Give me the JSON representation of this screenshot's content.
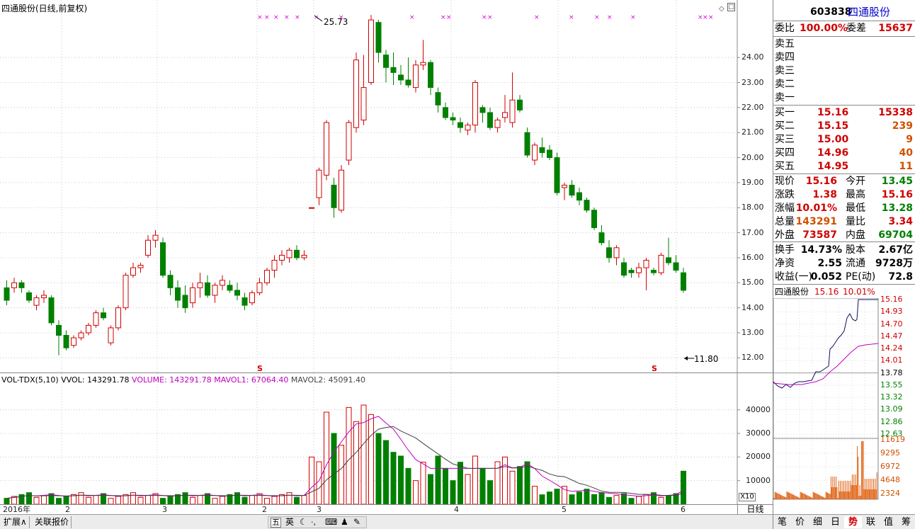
{
  "chart_header": {
    "title": "四通股份(日线,前复权)"
  },
  "price_axis": {
    "ticks": [
      "24.00",
      "23.00",
      "22.00",
      "21.00",
      "20.00",
      "19.00",
      "18.00",
      "17.00",
      "16.00",
      "15.00",
      "14.00",
      "13.00",
      "12.00"
    ]
  },
  "annotations": {
    "high_label": "25.73",
    "low_label": "11.80",
    "s_marker": "S"
  },
  "x_axis": {
    "labels": [
      "2016年",
      "2",
      "3",
      "2",
      "3",
      "4",
      "5",
      "6"
    ],
    "period_label": "日线",
    "scale_label": "X10"
  },
  "vol_header": {
    "indicator": "VOL-TDX(5,10)",
    "vvol": "VVOL: 143291.78",
    "volume": "VOLUME: 143291.78",
    "mavol1": "MAVOL1: 67064.40",
    "mavol2": "MAVOL2: 45091.40"
  },
  "vol_axis": {
    "ticks": [
      "40000",
      "30000",
      "20000",
      "10000"
    ]
  },
  "bottom_tabs": [
    "扩展∧",
    "关联报价"
  ],
  "tool_icons": [
    "五",
    "英"
  ],
  "colors": {
    "up": "#d00000",
    "down": "#008000",
    "ma1": "#c000c0",
    "ma2": "#404040",
    "marker": "#e000e0"
  },
  "quote": {
    "code": "603838",
    "name": "四通股份",
    "weibi_label": "委比",
    "weibi_value": "100.00%",
    "weicha_label": "委差",
    "weicha_value": "15637",
    "asks": [
      {
        "label": "卖五",
        "price": "",
        "vol": ""
      },
      {
        "label": "卖四",
        "price": "",
        "vol": ""
      },
      {
        "label": "卖三",
        "price": "",
        "vol": ""
      },
      {
        "label": "卖二",
        "price": "",
        "vol": ""
      },
      {
        "label": "卖一",
        "price": "",
        "vol": ""
      }
    ],
    "bids": [
      {
        "label": "买一",
        "price": "15.16",
        "vol": "15338"
      },
      {
        "label": "买二",
        "price": "15.15",
        "vol": "239"
      },
      {
        "label": "买三",
        "price": "15.00",
        "vol": "9"
      },
      {
        "label": "买四",
        "price": "14.96",
        "vol": "40"
      },
      {
        "label": "买五",
        "price": "14.95",
        "vol": "11"
      }
    ],
    "stats": [
      {
        "l1": "现价",
        "v1": "15.16",
        "l2": "今开",
        "v2": "13.45",
        "c1": "red",
        "c2": "green"
      },
      {
        "l1": "涨跌",
        "v1": "1.38",
        "l2": "最高",
        "v2": "15.16",
        "c1": "red",
        "c2": "red"
      },
      {
        "l1": "涨幅",
        "v1": "10.01%",
        "l2": "最低",
        "v2": "13.28",
        "c1": "red",
        "c2": "green"
      },
      {
        "l1": "总量",
        "v1": "143291",
        "l2": "量比",
        "v2": "3.34",
        "c1": "orange",
        "c2": "red"
      },
      {
        "l1": "外盘",
        "v1": "73587",
        "l2": "内盘",
        "v2": "69704",
        "c1": "red",
        "c2": "green"
      }
    ],
    "fundamentals": [
      {
        "l1": "换手",
        "v1": "14.73%",
        "l2": "股本",
        "v2": "2.67亿"
      },
      {
        "l1": "净资",
        "v1": "2.55",
        "l2": "流通",
        "v2": "9728万"
      },
      {
        "l1": "收益(一)",
        "v1": "0.052",
        "l2": "PE(动)",
        "v2": "72.8"
      }
    ]
  },
  "mini_chart": {
    "name": "四通股份",
    "price": "15.16",
    "pct": "10.01%",
    "price_ticks": [
      "15.16",
      "14.93",
      "14.70",
      "14.47",
      "14.24",
      "14.01",
      "13.78",
      "13.55",
      "13.32",
      "13.09",
      "12.86",
      "12.63"
    ],
    "vol_ticks": [
      "11619",
      "9295",
      "6972",
      "4648",
      "2324"
    ]
  },
  "right_tabs": [
    "笔",
    "价",
    "细",
    "日",
    "势",
    "联",
    "值",
    "筹"
  ],
  "chart_data": {
    "type": "candlestick",
    "title": "四通股份(日线,前复权)",
    "ylim": [
      11.5,
      25.9
    ],
    "series_note": "daily candles, 96 sessions, open/high/low/close in CNY",
    "candles": [
      [
        14.8,
        15.1,
        14.1,
        14.3
      ],
      [
        14.8,
        15.2,
        14.6,
        15.0
      ],
      [
        15.0,
        15.1,
        14.6,
        14.8
      ],
      [
        14.6,
        14.7,
        14.2,
        14.3
      ],
      [
        14.1,
        14.5,
        13.9,
        14.4
      ],
      [
        14.4,
        14.7,
        14.2,
        14.5
      ],
      [
        14.4,
        14.5,
        13.3,
        13.4
      ],
      [
        13.3,
        13.5,
        12.1,
        12.9
      ],
      [
        12.9,
        13.1,
        12.3,
        12.4
      ],
      [
        12.5,
        12.9,
        12.4,
        12.8
      ],
      [
        12.8,
        13.1,
        12.7,
        13.0
      ],
      [
        13.0,
        13.4,
        12.9,
        13.3
      ],
      [
        13.3,
        13.9,
        13.2,
        13.8
      ],
      [
        13.8,
        14.0,
        13.5,
        13.6
      ],
      [
        12.6,
        13.3,
        12.5,
        13.2
      ],
      [
        13.2,
        14.1,
        13.1,
        14.0
      ],
      [
        14.0,
        15.4,
        13.9,
        15.3
      ],
      [
        15.3,
        15.8,
        15.2,
        15.6
      ],
      [
        15.6,
        15.8,
        15.4,
        15.7
      ],
      [
        16.1,
        16.9,
        16.0,
        16.7
      ],
      [
        16.7,
        17.1,
        16.4,
        16.9
      ],
      [
        16.6,
        16.8,
        15.2,
        15.3
      ],
      [
        15.3,
        15.5,
        14.5,
        14.8
      ],
      [
        14.8,
        15.1,
        14.0,
        14.3
      ],
      [
        14.5,
        14.9,
        13.8,
        14.0
      ],
      [
        14.2,
        15.0,
        14.0,
        14.8
      ],
      [
        14.8,
        15.4,
        14.4,
        15.0
      ],
      [
        15.0,
        15.3,
        14.4,
        14.5
      ],
      [
        14.5,
        15.0,
        14.2,
        14.9
      ],
      [
        14.9,
        15.3,
        14.7,
        15.1
      ],
      [
        14.9,
        15.1,
        14.6,
        14.7
      ],
      [
        14.7,
        15.0,
        14.3,
        14.5
      ],
      [
        14.4,
        14.6,
        13.9,
        14.1
      ],
      [
        14.2,
        14.7,
        14.1,
        14.6
      ],
      [
        14.6,
        15.2,
        14.5,
        15.0
      ],
      [
        15.0,
        15.6,
        14.9,
        15.5
      ],
      [
        15.5,
        16.1,
        15.2,
        15.9
      ],
      [
        15.9,
        16.3,
        15.7,
        16.1
      ],
      [
        16.0,
        16.4,
        15.8,
        16.3
      ],
      [
        16.3,
        16.5,
        15.9,
        16.0
      ],
      [
        16.0,
        16.3,
        15.9,
        16.1
      ],
      [
        18.0,
        18.0,
        18.0,
        18.0
      ],
      [
        18.4,
        19.6,
        18.1,
        19.5
      ],
      [
        19.3,
        21.5,
        19.1,
        21.4
      ],
      [
        18.9,
        19.2,
        17.6,
        18.0
      ],
      [
        17.9,
        19.7,
        17.8,
        19.5
      ],
      [
        19.9,
        21.5,
        19.7,
        21.4
      ],
      [
        21.2,
        24.2,
        21.0,
        23.9
      ],
      [
        21.5,
        24.1,
        21.3,
        22.8
      ],
      [
        23.0,
        25.7,
        22.9,
        25.5
      ],
      [
        25.4,
        25.5,
        23.8,
        24.2
      ],
      [
        24.1,
        24.3,
        23.0,
        23.6
      ],
      [
        23.6,
        24.2,
        22.9,
        23.4
      ],
      [
        23.3,
        23.7,
        22.9,
        23.1
      ],
      [
        23.1,
        24.0,
        22.8,
        22.9
      ],
      [
        22.8,
        23.9,
        22.6,
        23.7
      ],
      [
        23.7,
        24.7,
        23.5,
        23.8
      ],
      [
        23.8,
        23.9,
        22.5,
        22.8
      ],
      [
        22.6,
        22.8,
        21.8,
        22.1
      ],
      [
        22.0,
        22.2,
        21.5,
        21.6
      ],
      [
        21.6,
        21.8,
        21.3,
        21.5
      ],
      [
        21.4,
        21.6,
        21.0,
        21.2
      ],
      [
        21.1,
        21.4,
        20.9,
        21.3
      ],
      [
        21.3,
        23.1,
        21.0,
        23.0
      ],
      [
        22.0,
        22.1,
        21.4,
        21.8
      ],
      [
        21.8,
        22.0,
        21.1,
        21.2
      ],
      [
        21.2,
        21.6,
        21.0,
        21.5
      ],
      [
        21.6,
        22.5,
        21.4,
        21.8
      ],
      [
        21.4,
        23.4,
        21.2,
        22.3
      ],
      [
        22.3,
        22.5,
        21.8,
        21.9
      ],
      [
        21.0,
        21.2,
        20.0,
        20.1
      ],
      [
        19.9,
        20.6,
        19.7,
        20.5
      ],
      [
        20.4,
        20.8,
        20.0,
        20.2
      ],
      [
        20.3,
        20.5,
        19.9,
        20.0
      ],
      [
        20.0,
        20.2,
        18.5,
        18.6
      ],
      [
        18.8,
        19.0,
        18.3,
        18.9
      ],
      [
        18.9,
        19.1,
        18.4,
        18.5
      ],
      [
        18.6,
        18.8,
        18.1,
        18.3
      ],
      [
        18.3,
        18.4,
        17.8,
        17.9
      ],
      [
        17.9,
        18.0,
        17.1,
        17.2
      ],
      [
        17.0,
        17.3,
        16.5,
        16.6
      ],
      [
        16.4,
        16.7,
        15.8,
        16.0
      ],
      [
        16.0,
        16.5,
        15.7,
        16.4
      ],
      [
        15.8,
        16.0,
        15.2,
        15.3
      ],
      [
        15.5,
        15.6,
        15.2,
        15.4
      ],
      [
        15.4,
        15.8,
        15.2,
        15.6
      ],
      [
        15.6,
        16.0,
        14.7,
        15.9
      ],
      [
        15.5,
        15.6,
        15.3,
        15.4
      ],
      [
        15.4,
        16.2,
        15.3,
        16.1
      ],
      [
        16.0,
        16.8,
        15.7,
        15.8
      ],
      [
        15.8,
        16.1,
        15.4,
        15.5
      ],
      [
        15.4,
        15.6,
        14.6,
        14.7
      ]
    ]
  }
}
